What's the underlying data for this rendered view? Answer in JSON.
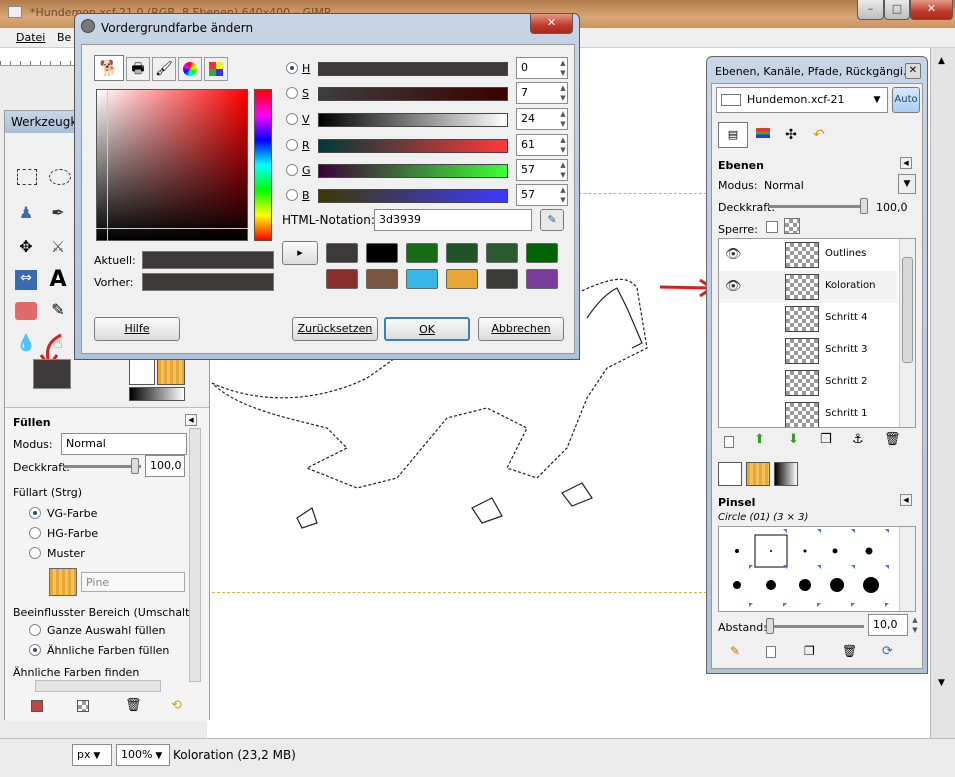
{
  "main_window": {
    "title": "*Hundemon.xcf-21.0 (RGB, 8 Ebenen) 640x400 – GIMP",
    "menu": [
      "Datei",
      "Be"
    ],
    "window_controls": {
      "minimize": "–",
      "maximize": "□",
      "close": "✕"
    }
  },
  "statusbar": {
    "unit": "px",
    "zoom": "100%",
    "info": "Koloration (23,2 MB)"
  },
  "toolbox": {
    "title": "Werkzeugk",
    "fill": {
      "title": "Füllen",
      "mode_label": "Modus:",
      "mode_value": "Normal",
      "opacity_label": "Deckkraft:",
      "opacity_value": "100,0",
      "fill_type_label": "Füllart  (Strg)",
      "options": [
        "VG-Farbe",
        "HG-Farbe",
        "Muster"
      ],
      "pattern_name": "Pine",
      "affected_label": "Beeinflusster Bereich  (Umschalt)",
      "affected_options": [
        "Ganze Auswahl füllen",
        "Ähnliche Farben füllen"
      ],
      "find_similar_label": "Ähnliche Farben finden"
    },
    "fg_color": "#3d3939"
  },
  "color_dialog": {
    "title": "Vordergrundfarbe ändern",
    "close": "✕",
    "channels": [
      {
        "label": "H",
        "value": "0"
      },
      {
        "label": "S",
        "value": "7"
      },
      {
        "label": "V",
        "value": "24"
      },
      {
        "label": "R",
        "value": "61"
      },
      {
        "label": "G",
        "value": "57"
      },
      {
        "label": "B",
        "value": "57"
      }
    ],
    "html_label": "HTML-Notation:",
    "html_value": "3d3939",
    "current_label": "Aktuell:",
    "previous_label": "Vorher:",
    "history_colors": [
      "#3d3939",
      "#000000",
      "#176b17",
      "#1f5427",
      "#2d5a2d",
      "#006400",
      "#8b2e2e",
      "#7a5540",
      "#38b6e8",
      "#e8a632",
      "#3a3a36",
      "#7a3c9a"
    ],
    "buttons": {
      "help": "Hilfe",
      "reset": "Zurücksetzen",
      "ok": "OK",
      "cancel": "Abbrechen"
    }
  },
  "layers_dock": {
    "title": "Ebenen, Kanäle, Pfade, Rückgängi...",
    "image_name": "Hundemon.xcf-21",
    "auto_label": "Auto",
    "panel_title": "Ebenen",
    "mode_label": "Modus:",
    "mode_value": "Normal",
    "opacity_label": "Deckkraft:",
    "opacity_value": "100,0",
    "lock_label": "Sperre:",
    "layers": [
      {
        "name": "Outlines",
        "visible": true
      },
      {
        "name": "Koloration",
        "visible": true
      },
      {
        "name": "Schritt 4",
        "visible": false
      },
      {
        "name": "Schritt 3",
        "visible": false
      },
      {
        "name": "Schritt 2",
        "visible": false
      },
      {
        "name": "Schritt 1",
        "visible": false
      }
    ],
    "brush_title": "Pinsel",
    "brush_name": "Circle (01) (3 × 3)",
    "spacing_label": "Abstand:",
    "spacing_value": "10,0"
  },
  "annotation_color": "#d42020"
}
